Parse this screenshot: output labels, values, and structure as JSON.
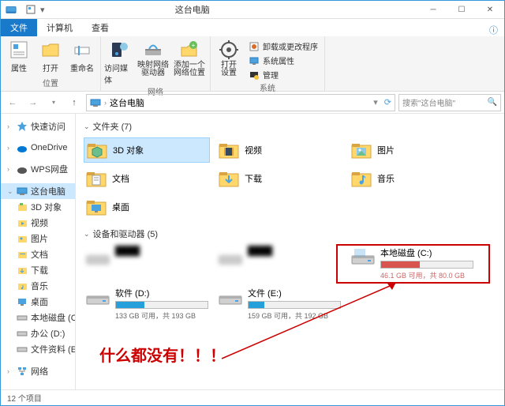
{
  "titlebar": {
    "title": "这台电脑"
  },
  "tabs": {
    "file": "文件",
    "computer": "计算机",
    "view": "查看"
  },
  "ribbon": {
    "props": "属性",
    "open": "打开",
    "rename": "重命名",
    "media": "访问媒体",
    "mapdrive": "映射网络\n驱动器",
    "addloc": "添加一个\n网络位置",
    "opensettings": "打开\n设置",
    "uninstall": "卸载或更改程序",
    "sysprops": "系统属性",
    "manage": "管理",
    "g_location": "位置",
    "g_network": "网络",
    "g_system": "系统"
  },
  "addr": {
    "path": "这台电脑",
    "search_ph": "搜索\"这台电脑\""
  },
  "nav": {
    "quick": "快速访问",
    "onedrive": "OneDrive",
    "wps": "WPS网盘",
    "thispc": "这台电脑",
    "obj3d": "3D 对象",
    "videos": "视频",
    "pictures": "图片",
    "docs": "文档",
    "downloads": "下载",
    "music": "音乐",
    "desktop": "桌面",
    "localc": "本地磁盘 (C:)",
    "work": "办公 (D:)",
    "files": "文件资料 (E:)",
    "network": "网络"
  },
  "content": {
    "folders_h": "文件夹 (7)",
    "drives_h": "设备和驱动器 (5)",
    "folders": {
      "obj3d": "3D 对象",
      "videos": "视频",
      "pictures": "图片",
      "docs": "文档",
      "downloads": "下载",
      "music": "音乐",
      "desktop": "桌面"
    },
    "drives": {
      "c": {
        "name": "本地磁盘 (C:)",
        "info": "46.1 GB 可用，共 80.0 GB",
        "pct": 42
      },
      "d": {
        "name": "软件 (D:)",
        "info": "133 GB 可用，共 193 GB",
        "pct": 31
      },
      "e": {
        "name": "文件 (E:)",
        "info": "159 GB 可用，共 192 GB",
        "pct": 17
      }
    }
  },
  "annotation": "什么都没有！！！",
  "status": {
    "count": "12 个项目"
  }
}
